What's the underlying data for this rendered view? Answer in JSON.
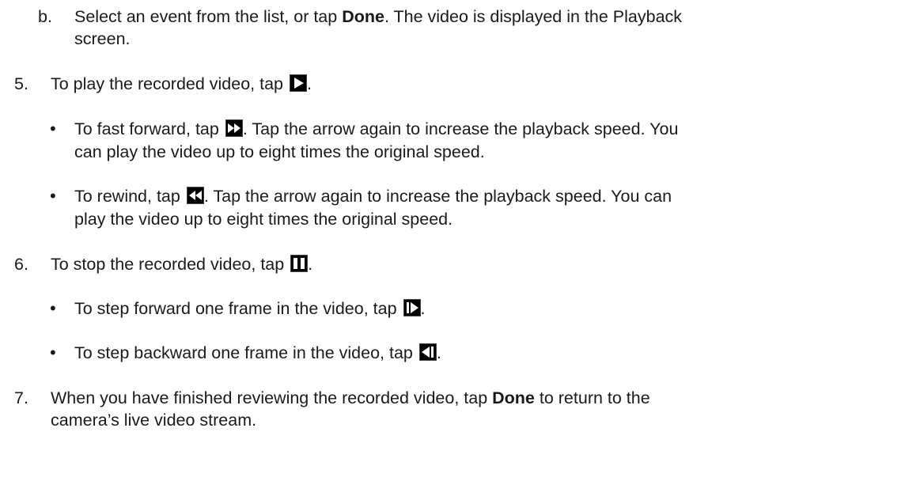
{
  "step4b": {
    "marker": "b.",
    "line1_pre": "Select an event from the list, or tap ",
    "line1_bold": "Done",
    "line1_post": ". The video is displayed in the Playback",
    "line2": "screen."
  },
  "step5": {
    "marker": "5.",
    "text_pre": "To play the recorded video, tap ",
    "text_post": ".",
    "icon": "play-icon",
    "bullet_ff": {
      "pre": "To fast forward, tap ",
      "post": ". Tap the arrow again to increase the playback speed. You",
      "line2": "can play the video up to eight times the original speed.",
      "icon": "fast-forward-icon"
    },
    "bullet_rw": {
      "pre": "To rewind, tap ",
      "post": ". Tap the arrow again to increase the playback speed. You can",
      "line2": "play the video up to eight times the original speed.",
      "icon": "rewind-icon"
    }
  },
  "step6": {
    "marker": "6.",
    "text_pre": "To stop the recorded video, tap ",
    "text_post": ".",
    "icon": "pause-icon",
    "bullet_sf": {
      "pre": "To step forward one frame in the video, tap ",
      "post": ".",
      "icon": "step-forward-icon"
    },
    "bullet_sb": {
      "pre": "To step backward one frame in the video, tap ",
      "post": ".",
      "icon": "step-backward-icon"
    }
  },
  "step7": {
    "marker": "7.",
    "line1_pre": "When you have finished reviewing the recorded video, tap ",
    "line1_bold": "Done",
    "line1_post": " to return to the",
    "line2": "camera’s live video stream."
  },
  "bullet_glyph": "•"
}
